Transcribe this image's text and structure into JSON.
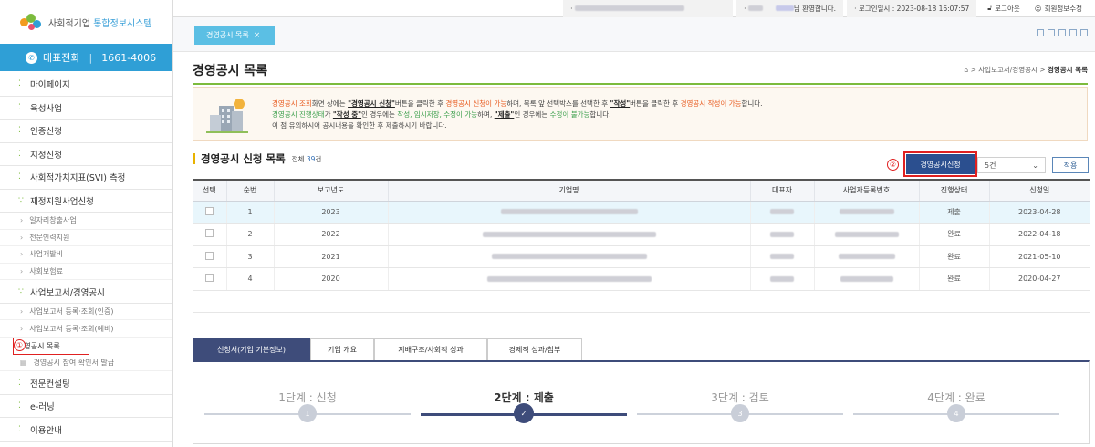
{
  "logo": {
    "text_plain": "사회적기업 ",
    "text_brand": "통합정보시스템"
  },
  "phone": {
    "label": "대표전화",
    "number": "1661-4006"
  },
  "sidebar": {
    "items": [
      {
        "type": "m1",
        "label": "마이페이지"
      },
      {
        "type": "m1",
        "label": "육성사업"
      },
      {
        "type": "m1",
        "label": "인증신청"
      },
      {
        "type": "m1",
        "label": "지정신청"
      },
      {
        "type": "m1",
        "label": "사회적가치지표(SVI) 측정"
      },
      {
        "type": "m1",
        "label": "재정지원사업신청",
        "open": true
      },
      {
        "type": "m2",
        "label": "일자리창출사업"
      },
      {
        "type": "m2",
        "label": "전문인력지원"
      },
      {
        "type": "m2",
        "label": "사업개발비"
      },
      {
        "type": "m2",
        "label": "사회보험료"
      },
      {
        "type": "m1",
        "label": "사업보고서/경영공시",
        "open": true
      },
      {
        "type": "m2",
        "label": "사업보고서 등록·조회(인증)"
      },
      {
        "type": "m2",
        "label": "사업보고서 등록·조회(예비)"
      },
      {
        "type": "m2",
        "label": "경영공시 목록",
        "active": true
      },
      {
        "type": "m2",
        "label": "경영공시 참여 확인서 발급"
      },
      {
        "type": "m1",
        "label": "전문컨설팅"
      },
      {
        "type": "m1",
        "label": "e-러닝"
      },
      {
        "type": "m1",
        "label": "이용안내"
      }
    ],
    "marker1": "①"
  },
  "topbar": {
    "welcome": "님 환영합니다.",
    "login_time": "· 로그인일시 : 2023-08-18 16:07:57",
    "logout": "로그아웃",
    "profile": "회원정보수정"
  },
  "tabstrip": {
    "tab_label": "경영공시 목록",
    "close": "×"
  },
  "page": {
    "title": "경영공시 목록",
    "breadcrumb_mid": "사업보고서/경영공시",
    "breadcrumb_sep": ">",
    "breadcrumb_cur": "경영공시 목록"
  },
  "notice": {
    "l1": [
      "경영공시 조회",
      "화면 상에는 ",
      "\"경영공시 신청\"",
      "버튼을 클릭한 후 ",
      "경영공시 신청이 가능",
      "하며, 목록 앞 선택박스를 선택한 후 ",
      "\"작성\"",
      "버튼을 클릭한 후 ",
      "경영공시 작성이 가능",
      "합니다."
    ],
    "l2": [
      "경영공시 진행상태",
      "가 ",
      "\"작성 중\"",
      "인 경우에는 ",
      "작성, 임시저장, 수정이 가능",
      "하며, ",
      "\"제출\"",
      "인 경우에는 ",
      "수정이 불가능",
      "합니다."
    ],
    "l3": "이 점 유의하시어 공시내용을 확인한 후 제출하시기 바랍니다."
  },
  "list": {
    "title": "경영공시 신청 목록",
    "count_prefix": "전체 ",
    "count": "39",
    "count_suffix": "건",
    "apply_button": "경영공시신청",
    "marker2": "②",
    "page_size": "5건",
    "apply_label": "적용",
    "columns": [
      "선택",
      "순번",
      "보고년도",
      "기업명",
      "대표자",
      "사업자등록번호",
      "진행상태",
      "신청일"
    ],
    "rows": [
      {
        "no": "1",
        "year": "2023",
        "status": "제출",
        "date": "2023-04-28"
      },
      {
        "no": "2",
        "year": "2022",
        "status": "완료",
        "date": "2022-04-18"
      },
      {
        "no": "3",
        "year": "2021",
        "status": "완료",
        "date": "2021-05-10"
      },
      {
        "no": "4",
        "year": "2020",
        "status": "완료",
        "date": "2020-04-27"
      }
    ]
  },
  "bottom_tabs": [
    "신청서(기업 기본정보)",
    "기업 개요",
    "지배구조/사회적 성과",
    "경제적 성과/첨부"
  ],
  "steps": [
    {
      "label": "1단계 : 신청",
      "num": "1"
    },
    {
      "label": "2단계 : 제출",
      "num": "✓"
    },
    {
      "label": "3단계 : 검토",
      "num": "3"
    },
    {
      "label": "4단계 : 완료",
      "num": "4"
    }
  ],
  "colors": {
    "accent": "#2f9fd6",
    "navy": "#3e4c7a",
    "button": "#2b4f8f",
    "highlight": "#e02020",
    "green": "#7cbb3d"
  }
}
